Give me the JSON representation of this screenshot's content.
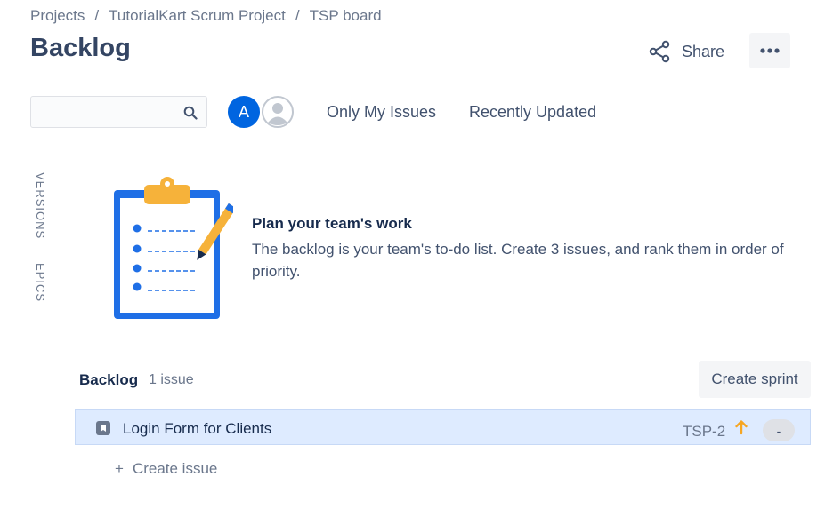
{
  "breadcrumb": {
    "items": [
      "Projects",
      "TutorialKart Scrum Project",
      "TSP board"
    ],
    "separator": "/"
  },
  "page": {
    "title": "Backlog"
  },
  "header": {
    "share_label": "Share",
    "more_icon": "more-icon"
  },
  "filters": {
    "search_value": "",
    "avatar_initial": "A",
    "only_my_issues": "Only My Issues",
    "recently_updated": "Recently Updated"
  },
  "side_tabs": {
    "versions": "VERSIONS",
    "epics": "EPICS"
  },
  "empty_state": {
    "title": "Plan your team's work",
    "description": "The backlog is your team's to-do list. Create 3 issues, and rank them in order of priority."
  },
  "backlog": {
    "title": "Backlog",
    "issue_count": "1 issue",
    "create_sprint_label": "Create sprint",
    "issues": [
      {
        "summary": "Login Form for Clients",
        "key": "TSP-2",
        "priority": "priority-up-icon",
        "estimate": "-"
      }
    ],
    "create_issue_label": "Create issue"
  },
  "colors": {
    "accent": "#0065e0",
    "selected_row": "#deebff",
    "priority": "#f6a623"
  }
}
